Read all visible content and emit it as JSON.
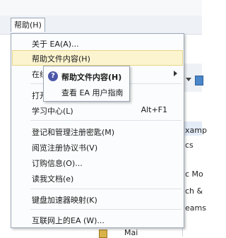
{
  "menubar": {
    "prev_menu_label": "",
    "help_menu_label": "帮助(H)"
  },
  "help_menu": {
    "items": [
      {
        "label": "关于 EA(A)..."
      },
      {
        "label": "帮助文件内容(H)"
      },
      {
        "label": "在线..."
      },
      {
        "label": "打开..."
      },
      {
        "label": "学习中心(L)",
        "accelerator": "Alt+F1"
      },
      {
        "label": "登记和管理注册密匙(M)"
      },
      {
        "label": "阅览注册协议书(V)"
      },
      {
        "label": "订购信息(O)..."
      },
      {
        "label": "读我文档(e)"
      },
      {
        "label": "键盘加速器映射(K)"
      },
      {
        "label": "互联网上的EA (W)..."
      }
    ]
  },
  "help_submenu": {
    "items": [
      {
        "label": "帮助文件内容(H)",
        "icon": "help-circle-icon"
      },
      {
        "label": "查看 EA 用户指南"
      }
    ]
  },
  "background": {
    "snippets": [
      "xamp",
      "cs",
      "c Mo",
      "ch &",
      "eams",
      "Mai"
    ]
  },
  "colors": {
    "menu_highlight": "#fbf4cf",
    "menu_border": "#9aa6b5",
    "help_icon": "#4b57a8"
  }
}
